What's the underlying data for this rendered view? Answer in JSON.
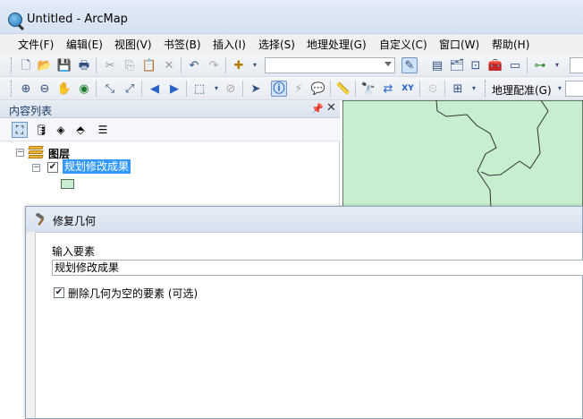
{
  "window": {
    "title": "Untitled - ArcMap"
  },
  "menubar": {
    "items": [
      {
        "label": "文件(F)"
      },
      {
        "label": "编辑(E)"
      },
      {
        "label": "视图(V)"
      },
      {
        "label": "书签(B)"
      },
      {
        "label": "插入(I)"
      },
      {
        "label": "选择(S)"
      },
      {
        "label": "地理处理(G)"
      },
      {
        "label": "自定义(C)"
      },
      {
        "label": "窗口(W)"
      },
      {
        "label": "帮助(H)"
      }
    ]
  },
  "toolbar": {
    "scale_value": "",
    "georef_label": "地理配准(G)",
    "georef_value": ""
  },
  "toc": {
    "title": "内容列表",
    "layers_group": "图层",
    "layer_name": "规划修改成果",
    "layer_checked": true,
    "swatch_color": "#c7efcf"
  },
  "map": {
    "polygon_fill": "#c7efcf"
  },
  "dialog": {
    "title": "修复几何",
    "input_label": "输入要素",
    "input_value": "规划修改成果",
    "delete_null_label": "删除几何为空的要素 (可选)",
    "delete_null_checked": true
  }
}
